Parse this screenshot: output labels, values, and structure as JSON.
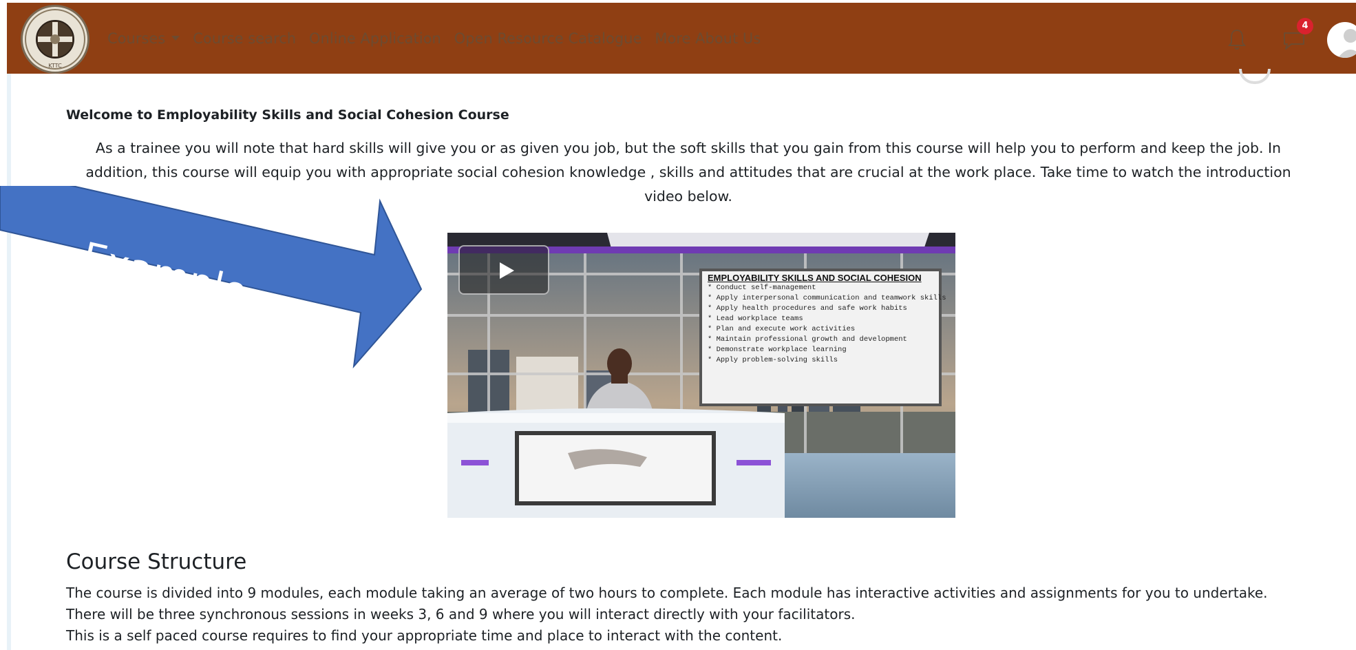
{
  "navbar": {
    "logo_text": "TECHNICAL TRAINERS COLLEGE KTTC KENYA",
    "links": [
      "Courses",
      "Course search",
      "Online Application",
      "Open Resource Catalogue",
      "More About Us"
    ],
    "courses_caret_icon": "caret-down-icon",
    "notifications_icon": "bell-icon",
    "messages_icon": "chat-bubble-icon",
    "messages_badge": "4",
    "user_icon": "user-avatar-icon",
    "colors": {
      "bar": "#8f3f13",
      "link": "#6d4b30",
      "badge": "#d9222e"
    }
  },
  "content": {
    "welcome_title": "Welcome to Employability Skills and Social Cohesion Course",
    "intro": "As a trainee you will note that hard skills will give you or as given you job, but the soft skills that you gain from this course will help you to perform and keep the job. In addition, this course will equip you with appropriate social cohesion knowledge , skills and attitudes that are crucial at the work place. Take time to watch the introduction video below.",
    "video": {
      "play_icon": "play-icon",
      "slide_title": "EMPLOYABILITY SKILLS AND SOCIAL COHESION",
      "slide_items": [
        "* Conduct self-management",
        "* Apply interpersonal communication and teamwork skills",
        "* Apply health procedures and safe work habits",
        "* Lead workplace teams",
        "* Plan and execute work activities",
        "* Maintain professional growth and development",
        "* Demonstrate workplace learning",
        "* Apply problem-solving skills"
      ]
    },
    "section_title": "Course Structure",
    "paragraphs": [
      "The course is divided into 9 modules, each module taking an average of two hours to complete. Each module has interactive activities and assignments for you to undertake. There will be three synchronous sessions in weeks 3, 6 and 9 where you will interact directly with your facilitators.",
      "This is a self paced course  requires to find your appropriate time and place to interact with the content."
    ]
  },
  "overlay": {
    "arrow_label": "Example",
    "arrow_color": "#4472c4"
  }
}
